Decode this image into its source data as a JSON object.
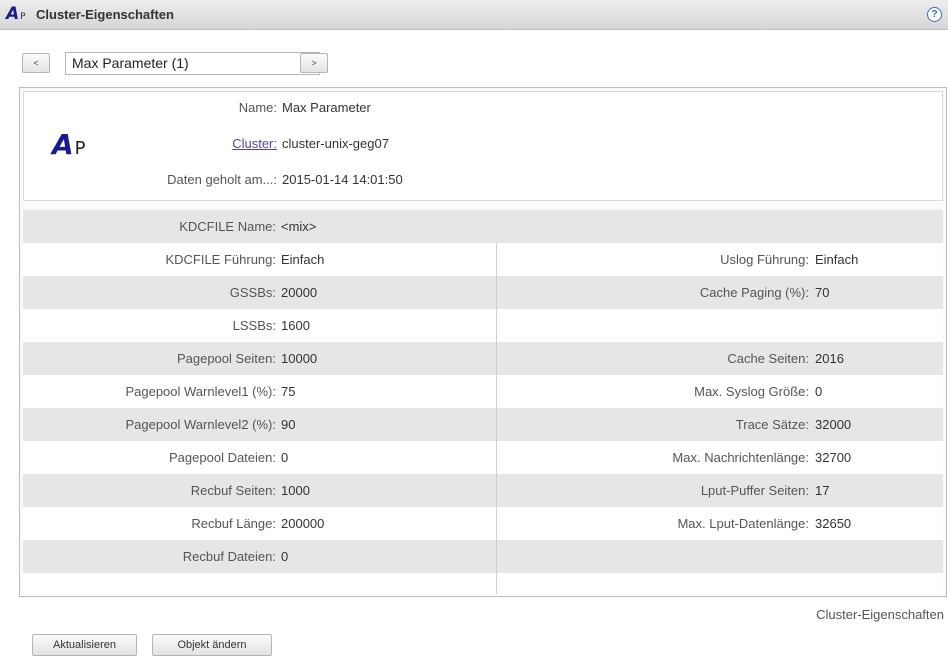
{
  "titlebar": {
    "logo_main": "A",
    "logo_sub": "P",
    "title": "Cluster-Eigenschaften",
    "help_symbol": "?"
  },
  "nav": {
    "prev_symbol": "<",
    "next_symbol": ">",
    "selected_object": "Max Parameter (1)",
    "caret": "▼"
  },
  "header": {
    "logo_main": "A",
    "logo_sub": "P",
    "rows": [
      {
        "label": "Name:",
        "value": "Max Parameter"
      },
      {
        "label": "Cluster:",
        "value": "cluster-unix-geg07"
      },
      {
        "label": "Daten geholt am...:",
        "value": "2015-01-14 14:01:50"
      }
    ]
  },
  "properties": {
    "kdcfile_name": {
      "label": "KDCFILE Name:",
      "value": "<mix>"
    },
    "left": [
      {
        "label": "KDCFILE Führung:",
        "value": "Einfach"
      },
      {
        "label": "GSSBs:",
        "value": "20000"
      },
      {
        "label": "LSSBs:",
        "value": "1600"
      },
      {
        "label": "Pagepool Seiten:",
        "value": "10000"
      },
      {
        "label": "Pagepool Warnlevel1 (%):",
        "value": "75"
      },
      {
        "label": "Pagepool Warnlevel2 (%):",
        "value": "90"
      },
      {
        "label": "Pagepool Dateien:",
        "value": "0"
      },
      {
        "label": "Recbuf Seiten:",
        "value": "1000"
      },
      {
        "label": "Recbuf Länge:",
        "value": "200000"
      },
      {
        "label": "Recbuf Dateien:",
        "value": "0"
      }
    ],
    "right": [
      {
        "label": "Uslog Führung:",
        "value": "Einfach"
      },
      {
        "label": "Cache Paging (%):",
        "value": "70"
      },
      {
        "label": "",
        "value": ""
      },
      {
        "label": "Cache Seiten:",
        "value": "2016"
      },
      {
        "label": "Max. Syslog Größe:",
        "value": "0"
      },
      {
        "label": "Trace Sätze:",
        "value": "32000"
      },
      {
        "label": "Max. Nachrichtenlänge:",
        "value": "32700"
      },
      {
        "label": "Lput-Puffer Seiten:",
        "value": "17"
      },
      {
        "label": "Max. Lput-Datenlänge:",
        "value": "32650"
      },
      {
        "label": "",
        "value": ""
      }
    ]
  },
  "footer": {
    "section_label": "Cluster-Eigenschaften",
    "refresh_label": "Aktualisieren",
    "edit_label": "Objekt ändern"
  },
  "colors": {
    "logo": "#1a1a8c",
    "link": "#5a3f9f",
    "row_alt": "#e6e6e6"
  }
}
